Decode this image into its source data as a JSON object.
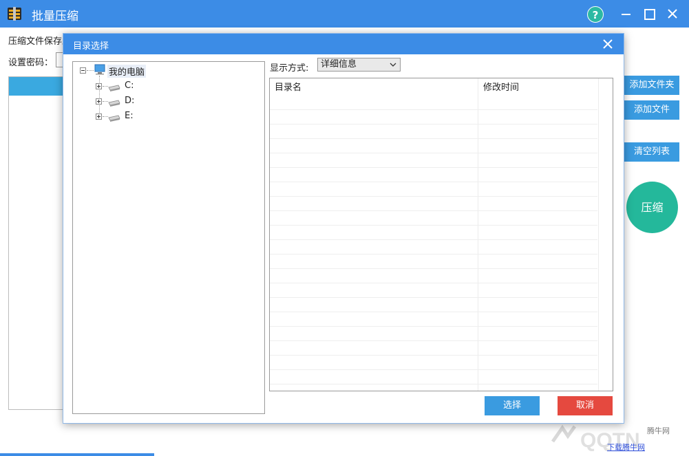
{
  "window": {
    "title": "批量压缩",
    "help_label": "?"
  },
  "main": {
    "save_path_label": "压缩文件保存路",
    "password_label": "设置密码：",
    "buttons": {
      "add_folder": "添加文件夹",
      "add_file": "添加文件",
      "clear_list": "清空列表",
      "compress": "压缩"
    }
  },
  "dialog": {
    "title": "目录选择",
    "tree": {
      "root": "我的电脑",
      "drives": [
        "C:",
        "D:",
        "E:"
      ]
    },
    "view_mode_label": "显示方式:",
    "view_mode_value": "详细信息",
    "table": {
      "columns": [
        "目录名",
        "修改时间"
      ],
      "rows": []
    },
    "select_button": "选择",
    "cancel_button": "取消"
  },
  "watermark": {
    "site_name": "腾牛网",
    "link_text": "下载腾牛网"
  },
  "colors": {
    "titlebar": "#3c8ce6",
    "button_blue": "#3a9be0",
    "button_red": "#e5493f",
    "compress_green": "#24b89b"
  }
}
